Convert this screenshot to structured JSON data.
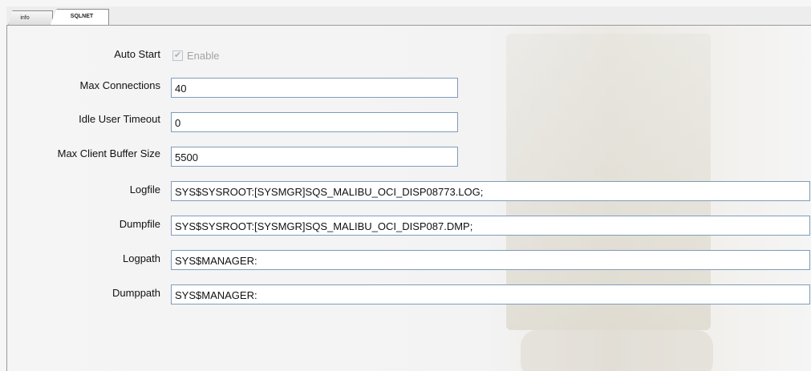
{
  "tabs": {
    "info_label": "info",
    "sqlnet_label": "SQLNET"
  },
  "auto_start": {
    "label": "Auto Start",
    "checkbox_label": "Enable",
    "checked": true,
    "enabled": false
  },
  "max_connections": {
    "label": "Max Connections",
    "value": "40"
  },
  "idle_user_timeout": {
    "label": "Idle User Timeout",
    "value": "0"
  },
  "max_client_buffer_size": {
    "label": "Max Client Buffer Size",
    "value": "5500"
  },
  "logfile": {
    "label": "Logfile",
    "value": "SYS$SYSROOT:[SYSMGR]SQS_MALIBU_OCI_DISP08773.LOG;"
  },
  "dumpfile": {
    "label": "Dumpfile",
    "value": "SYS$SYSROOT:[SYSMGR]SQS_MALIBU_OCI_DISP087.DMP;"
  },
  "logpath": {
    "label": "Logpath",
    "value": "SYS$MANAGER:"
  },
  "dumppath": {
    "label": "Dumppath",
    "value": "SYS$MANAGER:"
  },
  "colors": {
    "field_border": "#7f9db9",
    "disabled_text": "#a3a3a3"
  }
}
